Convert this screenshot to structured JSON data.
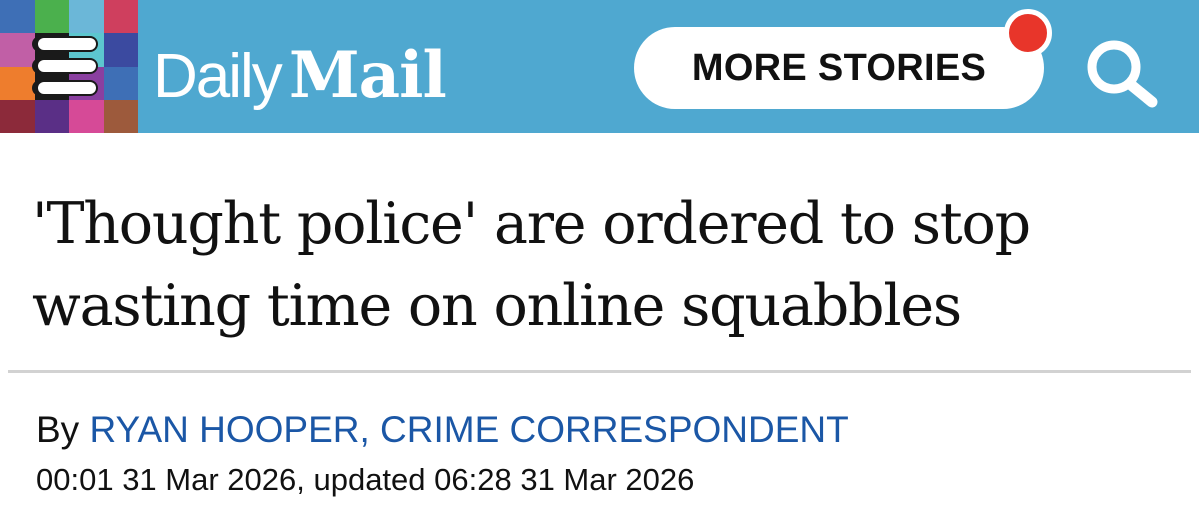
{
  "header": {
    "background_color": "#4fa8d0",
    "menu_icon": "hamburger-menu-icon",
    "mosaic_colors": [
      "#3e6fb6",
      "#4bb04d",
      "#6bb7d8",
      "#cf3f5e",
      "#c15fa6",
      "#1a1a1a",
      "#5cc6cf",
      "#3b4aa0",
      "#ee7d2d",
      "#1a1a1a",
      "#8a3fa0",
      "#3e6fb6",
      "#8c2a3a",
      "#5a2f86",
      "#d64a97",
      "#9d5a3c"
    ],
    "logo": {
      "word1": "Daily",
      "word2": "Mail"
    },
    "more_stories_label": "MORE STORIES",
    "notification_dot_color": "#e8352a",
    "search_icon": "search-icon"
  },
  "article": {
    "headline": "'Thought police' are ordered to stop wasting time on online squabbles",
    "byline_prefix": "By",
    "author": "RYAN HOOPER, CRIME CORRESPONDENT",
    "author_color": "#1b57a6",
    "dateline": "00:01 31 Mar 2026, updated 06:28 31 Mar 2026"
  }
}
